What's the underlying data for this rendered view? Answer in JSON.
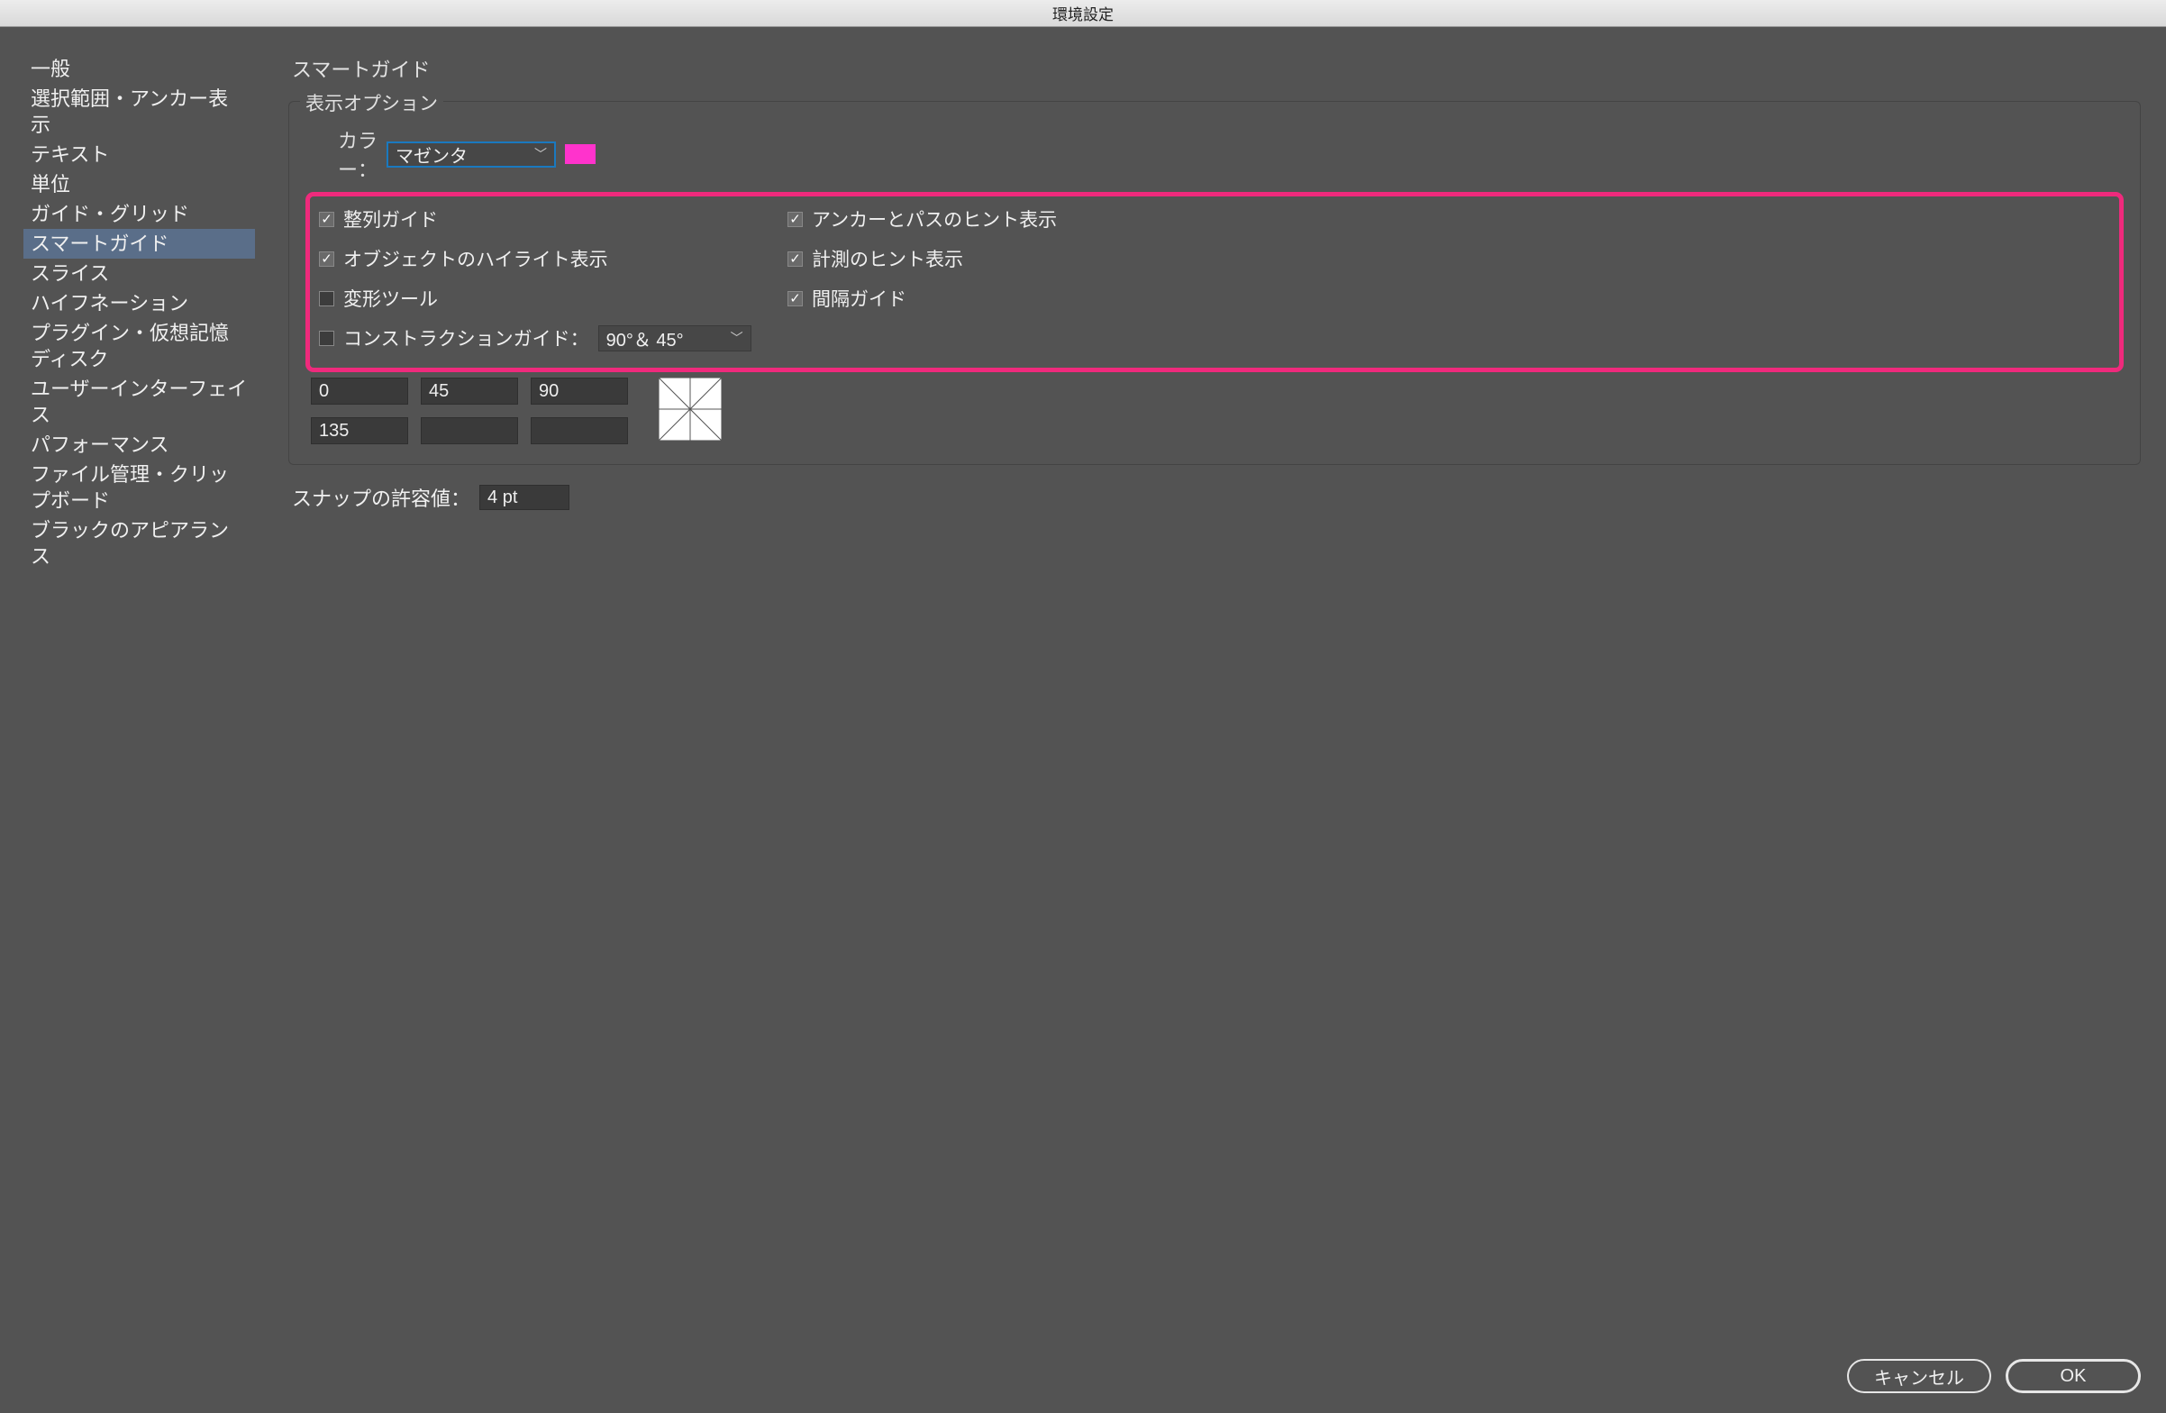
{
  "window": {
    "title": "環境設定"
  },
  "sidebar": {
    "items": [
      {
        "label": "一般"
      },
      {
        "label": "選択範囲・アンカー表示"
      },
      {
        "label": "テキスト"
      },
      {
        "label": "単位"
      },
      {
        "label": "ガイド・グリッド"
      },
      {
        "label": "スマートガイド"
      },
      {
        "label": "スライス"
      },
      {
        "label": "ハイフネーション"
      },
      {
        "label": "プラグイン・仮想記憶ディスク"
      },
      {
        "label": "ユーザーインターフェイス"
      },
      {
        "label": "パフォーマンス"
      },
      {
        "label": "ファイル管理・クリップボード"
      },
      {
        "label": "ブラックのアピアランス"
      }
    ],
    "selected_index": 5
  },
  "panel": {
    "title": "スマートガイド",
    "group_display_label": "表示オプション",
    "color_label": "カラー：",
    "color_select_value": "マゼンタ",
    "color_swatch_hex": "#ff33cc",
    "checkboxes_left": [
      {
        "label": "整列ガイド",
        "checked": true
      },
      {
        "label": "オブジェクトのハイライト表示",
        "checked": true
      },
      {
        "label": "変形ツール",
        "checked": false
      }
    ],
    "construction_guide": {
      "label": "コンストラクションガイド：",
      "checked": false,
      "select_value": "90°＆ 45°"
    },
    "checkboxes_right": [
      {
        "label": "アンカーとパスのヒント表示",
        "checked": true
      },
      {
        "label": "計測のヒント表示",
        "checked": true
      },
      {
        "label": "間隔ガイド",
        "checked": true
      }
    ],
    "angle_inputs": [
      "0",
      "45",
      "90",
      "135",
      "",
      ""
    ],
    "snap_label": "スナップの許容値：",
    "snap_value": "4 pt"
  },
  "footer": {
    "cancel_label": "キャンセル",
    "ok_label": "OK"
  }
}
